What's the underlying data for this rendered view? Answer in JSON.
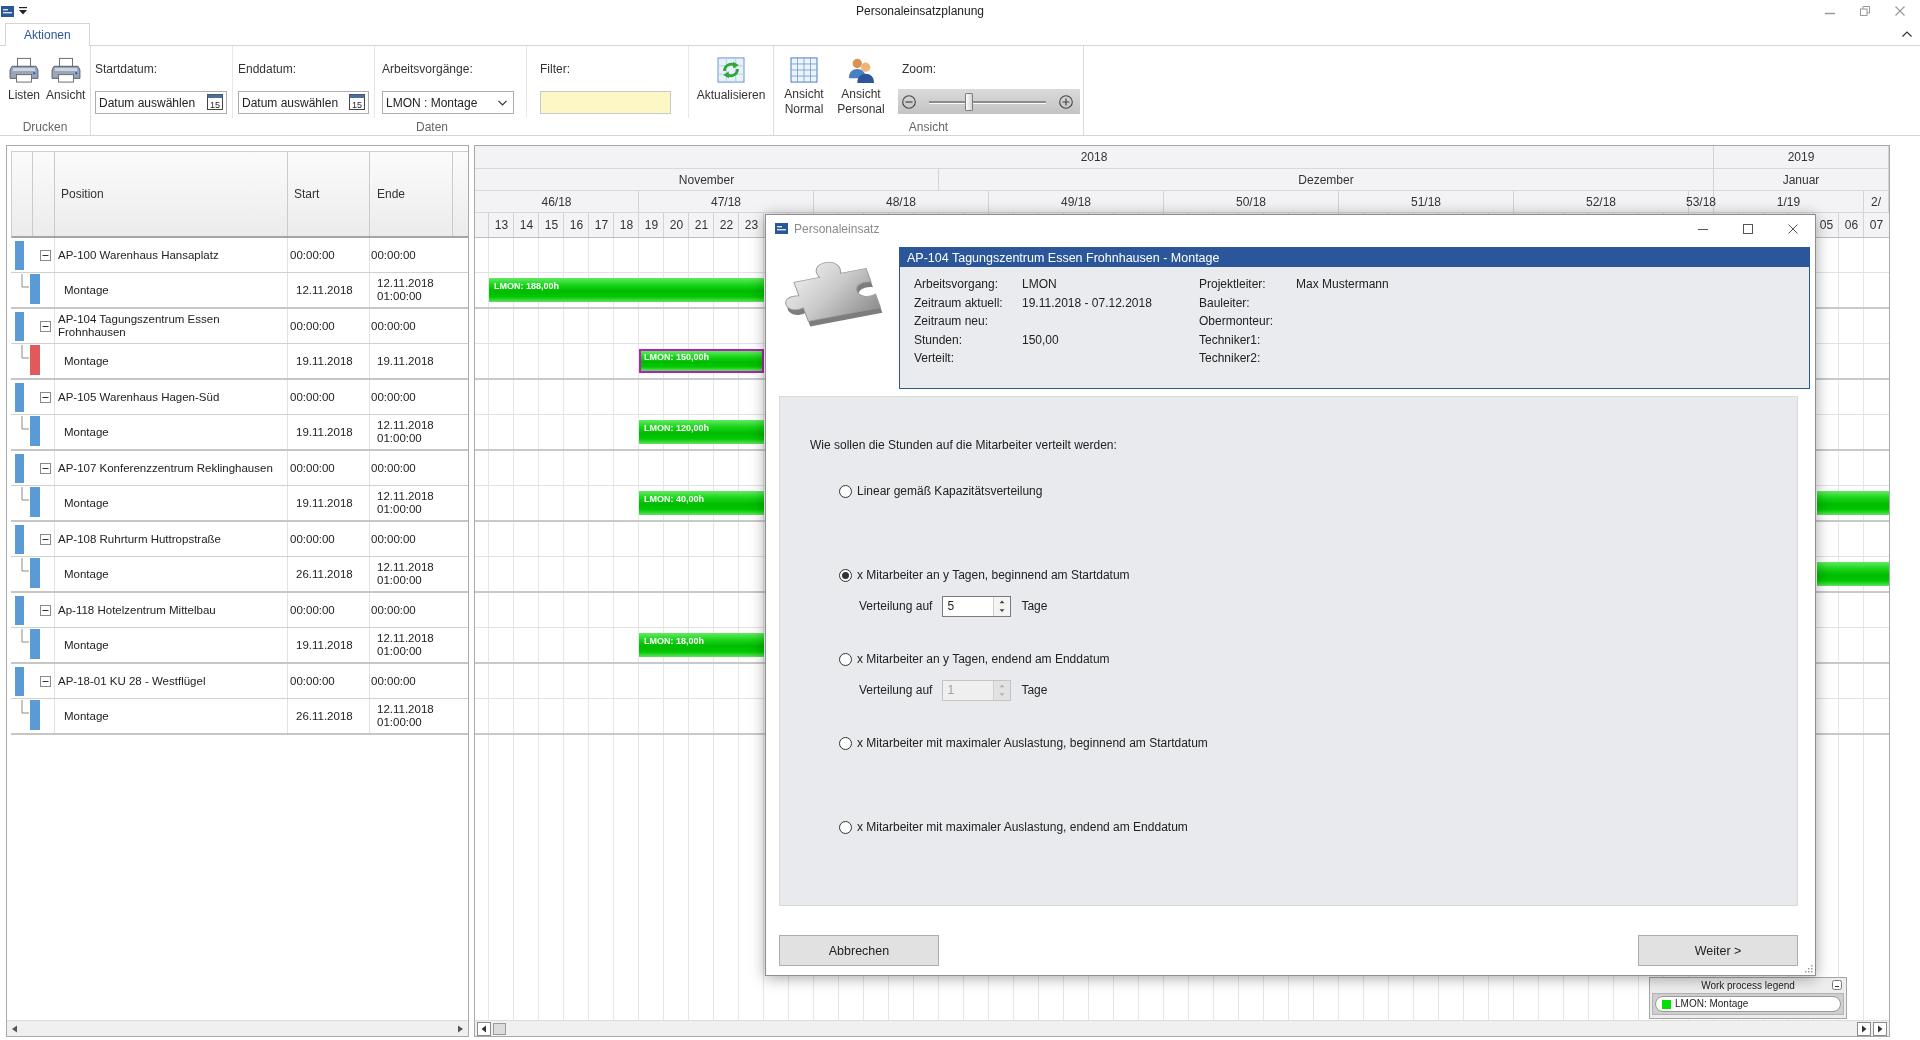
{
  "window": {
    "title": "Personaleinsatzplanung"
  },
  "ribbon_tabs": [
    {
      "label": "Aktionen",
      "selected": true
    }
  ],
  "ribbon": {
    "print_group": {
      "label": "Drucken",
      "buttons": [
        "Listen",
        "Ansicht"
      ]
    },
    "data_group": {
      "label": "Daten",
      "start_date": {
        "label": "Startdatum:",
        "placeholder": "Datum auswählen",
        "icon_text": "15"
      },
      "end_date": {
        "label": "Enddatum:",
        "placeholder": "Datum auswählen",
        "icon_text": "15"
      },
      "work_processes": {
        "label": "Arbeitsvorgänge:",
        "value": "LMON : Montage"
      },
      "filter": {
        "label": "Filter:"
      },
      "refresh_button": "Aktualisieren"
    },
    "view_group": {
      "label": "Ansicht",
      "buttons": [
        "Ansicht Normal",
        "Ansicht Personal"
      ],
      "zoom": {
        "label": "Zoom:",
        "level": 0.33
      }
    }
  },
  "grid": {
    "columns": [
      "Position",
      "Start",
      "Ende"
    ],
    "rows": [
      {
        "position": "AP-100 Warenhaus Hansaplatz",
        "start": "00:00:00",
        "end": "00:00:00",
        "color": "#5b9bd5",
        "expanded": true,
        "children": [
          {
            "position": "Montage",
            "start": "12.11.2018",
            "end": "12.11.2018 01:00:00",
            "color": "#5b9bd5"
          }
        ]
      },
      {
        "position": "AP-104 Tagungszentrum Essen Frohnhausen",
        "start": "00:00:00",
        "end": "00:00:00",
        "color": "#5b9bd5",
        "expanded": true,
        "children": [
          {
            "position": "Montage",
            "start": "19.11.2018",
            "end": "19.11.2018",
            "color": "#e05a5a"
          }
        ]
      },
      {
        "position": "AP-105 Warenhaus Hagen-Süd",
        "start": "00:00:00",
        "end": "00:00:00",
        "color": "#5b9bd5",
        "expanded": true,
        "children": [
          {
            "position": "Montage",
            "start": "19.11.2018",
            "end": "12.11.2018 01:00:00",
            "color": "#5b9bd5"
          }
        ]
      },
      {
        "position": "AP-107 Konferenzzentrum Reklinghausen",
        "start": "00:00:00",
        "end": "00:00:00",
        "color": "#5b9bd5",
        "expanded": true,
        "children": [
          {
            "position": "Montage",
            "start": "19.11.2018",
            "end": "12.11.2018 01:00:00",
            "color": "#5b9bd5"
          }
        ]
      },
      {
        "position": "AP-108 Ruhrturm Huttropstraße",
        "start": "00:00:00",
        "end": "00:00:00",
        "color": "#5b9bd5",
        "expanded": true,
        "children": [
          {
            "position": "Montage",
            "start": "26.11.2018",
            "end": "12.11.2018 01:00:00",
            "color": "#5b9bd5"
          }
        ]
      },
      {
        "position": "Ap-118 Hotelzentrum Mittelbau",
        "start": "00:00:00",
        "end": "00:00:00",
        "color": "#5b9bd5",
        "expanded": true,
        "children": [
          {
            "position": "Montage",
            "start": "19.11.2018",
            "end": "12.11.2018 01:00:00",
            "color": "#5b9bd5"
          }
        ]
      },
      {
        "position": "AP-18-01 KU 28 - Westflügel",
        "start": "00:00:00",
        "end": "00:00:00",
        "color": "#5b9bd5",
        "expanded": true,
        "children": [
          {
            "position": "Montage",
            "start": "26.11.2018",
            "end": "12.11.2018 01:00:00",
            "color": "#5b9bd5"
          }
        ]
      }
    ]
  },
  "gantt": {
    "years": [
      "2018",
      "2019"
    ],
    "months": [
      "November",
      "Dezember",
      "Januar"
    ],
    "weeks": [
      "46/18",
      "47/18",
      "48/18",
      "49/18",
      "50/18",
      "51/18",
      "52/18",
      "53/18",
      "1/19",
      "2/"
    ],
    "days": [
      "13",
      "14",
      "15",
      "16",
      "17",
      "18",
      "19",
      "20",
      "21",
      "22",
      "23",
      "05",
      "06",
      "07"
    ],
    "rows": [
      {
        "bars": [
          {
            "label": "LMON: 188,00h",
            "selected": false
          }
        ]
      },
      {
        "bars": [
          {
            "label": "LMON: 150,00h",
            "selected": true
          }
        ]
      },
      {
        "bars": [
          {
            "label": "LMON: 120,00h",
            "selected": false
          }
        ]
      },
      {
        "bars": [
          {
            "label": "LMON: 40,00h",
            "selected": false
          },
          {
            "selected": false
          }
        ]
      },
      {
        "bars": [
          {
            "selected": false
          }
        ]
      },
      {
        "bars": [
          {
            "label": "LMON: 18,00h",
            "selected": false
          }
        ]
      }
    ],
    "legend": {
      "title": "Work process legend",
      "items": [
        {
          "label": "LMON: Montage",
          "color": "#00e000"
        }
      ]
    }
  },
  "dialog": {
    "title": "Personaleinsatz",
    "info": {
      "heading": "AP-104 Tagungszentrum Essen Frohnhausen - Montage",
      "left": [
        {
          "label": "Arbeitsvorgang:",
          "value": "LMON"
        },
        {
          "label": "Zeitraum aktuell:",
          "value": "19.11.2018 - 07.12.2018"
        },
        {
          "label": "Zeitraum neu:"
        },
        {
          "label": "Stunden:",
          "value": "150,00"
        },
        {
          "label": "Verteilt:"
        }
      ],
      "right": [
        {
          "label": "Projektleiter:",
          "value": "Max Mustermann"
        },
        {
          "label": "Bauleiter:"
        },
        {
          "label": "Obermonteur:"
        },
        {
          "label": "Techniker1:"
        },
        {
          "label": "Techniker2:"
        }
      ]
    },
    "question": "Wie sollen die Stunden auf die Mitarbeiter verteilt werden:",
    "options": [
      {
        "label": "Linear gemäß Kapazitätsverteilung",
        "selected": false
      },
      {
        "label": "x Mitarbeiter an y Tagen, beginnend am Startdatum",
        "selected": true,
        "spin": {
          "label": "Verteilung auf",
          "value": "5",
          "unit": "Tage",
          "disabled": false
        }
      },
      {
        "label": "x Mitarbeiter an y Tagen, endend am Enddatum",
        "selected": false,
        "spin": {
          "label": "Verteilung auf",
          "value": "1",
          "unit": "Tage",
          "disabled": true
        }
      },
      {
        "label": "x Mitarbeiter mit maximaler Auslastung, beginnend am Startdatum",
        "selected": false
      },
      {
        "label": "x Mitarbeiter mit maximaler Auslastung, endend am Enddatum",
        "selected": false
      }
    ],
    "buttons": [
      "Abbrechen",
      "Weiter >"
    ]
  }
}
